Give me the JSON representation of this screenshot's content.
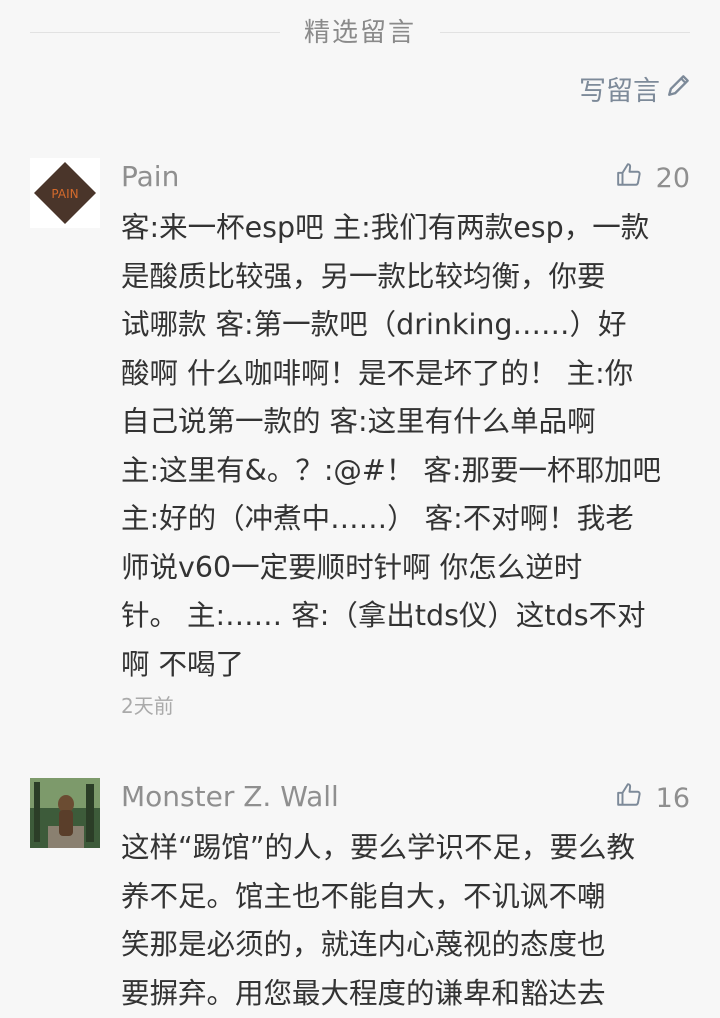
{
  "header": {
    "title": "精选留言"
  },
  "write_link": {
    "label": "写留言",
    "icon": "pencil-icon"
  },
  "comments": [
    {
      "name": "Pain",
      "avatar_text": "PAIN",
      "likes": "20",
      "content": "客:来一杯esp吧 主:我们有两款esp，一款\n是酸质比较强，另一款比较均衡，你要\n试哪款 客:第一款吧（drinking……）好\n酸啊 什么咖啡啊！是不是坏了的！ 主:你\n自己说第一款的 客:这里有什么单品啊\n主:这里有&。？:@#！ 客:那要一杯耶加吧\n主:好的（冲煮中……） 客:不对啊！我老\n师说v60一定要顺时针啊 你怎么逆时\n针。 主:…… 客:（拿出tds仪）这tds不对\n啊 不喝了",
      "time": "2天前"
    },
    {
      "name": "Monster Z. Wall",
      "likes": "16",
      "content": "这样“踢馆”的人，要么学识不足，要么教\n养不足。馆主也不能自大，不讥讽不嘲\n笑那是必须的，就连内心蔑视的态度也\n要摒弃。用您最大程度的谦卑和豁达去"
    }
  ],
  "colors": {
    "accent": "#7d8a99",
    "text": "#333333",
    "muted": "#8f8f8f"
  }
}
